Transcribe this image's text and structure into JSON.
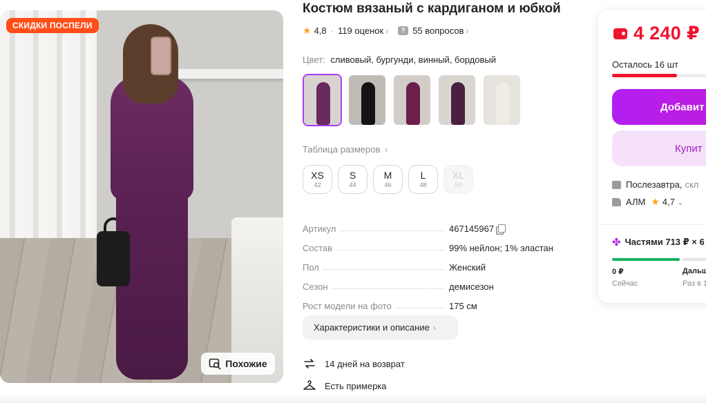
{
  "photo": {
    "badge": "СКИДКИ ПОСПЕЛИ",
    "similar_label": "Похожие"
  },
  "product": {
    "title": "Костюм вязаный с кардиганом и юбкой",
    "rating": "4,8",
    "reviews": "119 оценок",
    "questions": "55 вопросов",
    "color_label": "Цвет:",
    "color_value": "сливовый, бургунди, винный, бордовый",
    "size_table_label": "Таблица размеров",
    "sizes": [
      {
        "name": "XS",
        "num": "42",
        "available": true
      },
      {
        "name": "S",
        "num": "44",
        "available": true
      },
      {
        "name": "M",
        "num": "46",
        "available": true
      },
      {
        "name": "L",
        "num": "48",
        "available": true
      },
      {
        "name": "XL",
        "num": "50",
        "available": false
      }
    ],
    "specs": [
      {
        "key": "Артикул",
        "value": "467145967"
      },
      {
        "key": "Состав",
        "value": "99% нейлон; 1% эластан"
      },
      {
        "key": "Пол",
        "value": "Женский"
      },
      {
        "key": "Сезон",
        "value": "демисезон"
      },
      {
        "key": "Рост модели на фото",
        "value": "175 см"
      }
    ],
    "desc_button": "Характеристики и описание",
    "features": [
      {
        "icon": "return-arrows-icon",
        "text": "14 дней на возврат"
      },
      {
        "icon": "hanger-icon",
        "text": "Есть примерка"
      }
    ],
    "thumb_colors": [
      {
        "bg": "#d8d3cf",
        "fig": "#6a2a5f"
      },
      {
        "bg": "#bfbcb8",
        "fig": "#141414"
      },
      {
        "bg": "#d2cdc8",
        "fig": "#6b1f4a"
      },
      {
        "bg": "#d9d6d2",
        "fig": "#4b1f3f"
      },
      {
        "bg": "#e6e3de",
        "fig": "#efece6"
      }
    ]
  },
  "buy_card": {
    "price": "4 240 ₽",
    "stock": "Осталось 16 шт",
    "stock_fraction": 0.55,
    "add_button": "Добавит",
    "buy_button": "Купит",
    "delivery": "Послезавтра,",
    "delivery_more": "скл",
    "seller": "АЛМ",
    "seller_rating": "4,7",
    "parts": "Частями 713 ₽ × 6",
    "parts_now_amount": "0 ₽",
    "parts_now_label": "Сейчас",
    "parts_next_amount": "Дальш",
    "parts_next_label": "Раз в 1"
  },
  "colors": {
    "accent": "#a73afd",
    "price_red": "#f0142d",
    "sale_badge": "#ff4e19",
    "parts_green": "#17b25f"
  }
}
